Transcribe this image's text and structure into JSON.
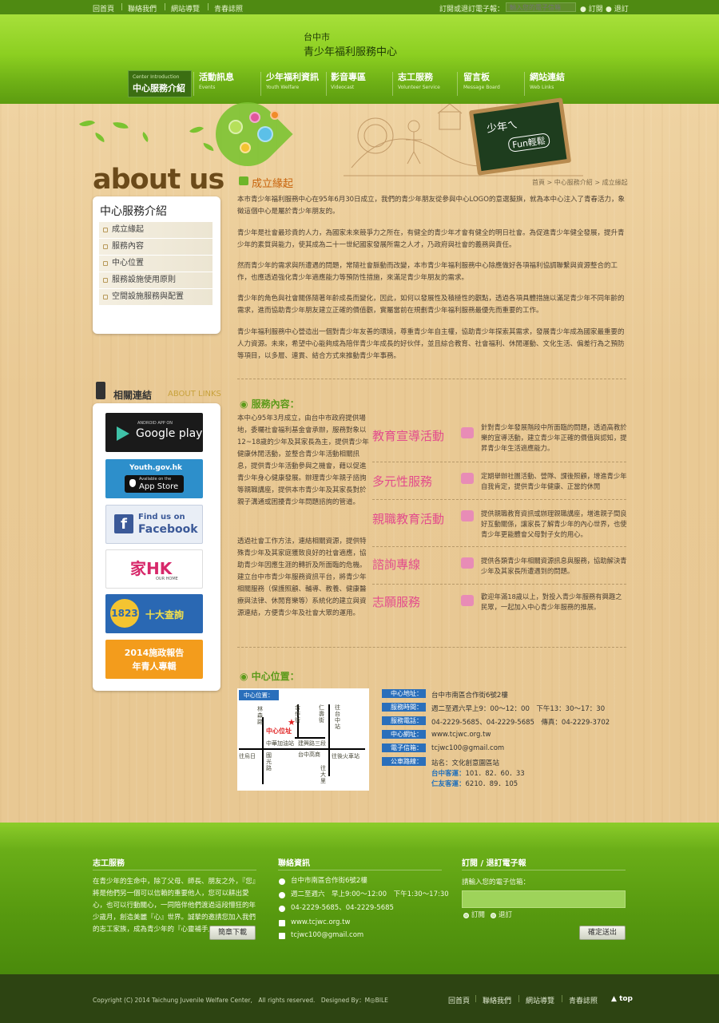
{
  "topbar": {
    "links": [
      "回首頁",
      "聯絡我們",
      "網站導覽",
      "青春誌照"
    ],
    "subscribe_label": "訂閱或退訂電子報：",
    "subscribe_placeholder": "輸入您的電子信箱",
    "subscribe_btn": "訂閱",
    "unsubscribe_btn": "退訂"
  },
  "header": {
    "title_line1": "台中市",
    "title_line2": "青少年福利服務中心"
  },
  "nav": [
    {
      "zh": "中心服務介紹",
      "en": "Center Introduction"
    },
    {
      "zh": "活動訊息",
      "en": "Events"
    },
    {
      "zh": "少年福利資訊",
      "en": "Youth Welfare"
    },
    {
      "zh": "影音專區",
      "en": "Videocast"
    },
    {
      "zh": "志工服務",
      "en": "Volunteer Service"
    },
    {
      "zh": "留言板",
      "en": "Message Board"
    },
    {
      "zh": "網站連結",
      "en": "Web Links"
    }
  ],
  "chalkboard": {
    "line1": "少年ㄟ",
    "line2": "Fun輕鬆"
  },
  "sidebar": {
    "about": "about us",
    "panel_title": "中心服務介紹",
    "items": [
      "成立緣起",
      "服務內容",
      "中心位置",
      "服務設施使用原則",
      "空間設施服務與配置"
    ],
    "links_title_zh": "相關連結",
    "links_title_en": "ABOUT LINKS",
    "links": [
      {
        "small": "ANDROID APP ON",
        "big": "Google play",
        "color": "#1a1a1a"
      },
      {
        "small": "Youth.gov.hk",
        "big": "App Store",
        "small2": "Available on the",
        "color": "#2d8fcb"
      },
      {
        "small": "Find us on",
        "big": "Facebook",
        "color": "#e9eef6"
      },
      {
        "small": "OUR HOME",
        "big": "家HK",
        "color": "#ffffff"
      },
      {
        "small": "1823",
        "big": "十大查詢",
        "color": "#2a68b3"
      },
      {
        "small": "2014施政報告",
        "big": "年青人專輯",
        "color": "#f39c1c"
      }
    ]
  },
  "breadcrumb": "首頁 > 中心服務介紹 > 成立緣起",
  "origin": {
    "title": "成立緣起",
    "paragraphs": [
      "本市青少年福利服務中心在95年6月30日成立，我們的青少年朋友從參與中心LOGO的意選擬旗，就為本中心注入了青春活力，象徵這個中心是屬於青少年朋友的。",
      "青少年是社會最珍貴的人力，為國家未來競爭力之所在，有健全的青少年才會有健全的明日社會。為促進青少年健全發展，提升青少年的素質與能力，使其成為二十一世紀國家發展所需之人才，乃政府與社會的義務與責任。",
      "然而青少年的需求與所遭遇的問題，常隨社會脈動而改變，本市青少年福利服務中心除應做好各項福利協調聯繫與資源整合的工作，也應透過強化青少年適應能力等預防性措施，來滿足青少年朋友的需求。",
      "青少年的角色與社會關係隨著年齡成長而變化，因此，如何以發展性及積極性的觀點，透過各項具體措施以滿足青少年不同年齡的需求，進而協助青少年朋友建立正確的價值觀，實屬當前在規劃青少年福利服務最優先而重要的工作。",
      "青少年福利服務中心營造出一個對青少年友善的環境，尊重青少年自主權，協助青少年探索其需求，發展青少年成為國家最重要的人力資源。未來，希望中心能夠成為陪伴青少年成長的好伙伴，並且綜合教育、社會福利、休閒運動、文化生活、偏差行為之預防等項目，以多層、連貫、結合方式來推動青少年事務。"
    ]
  },
  "services": {
    "title": "服務內容：",
    "intro1": "本中心95年3月成立，由台中市政府提供場地，委囑社會福利基金會承辦，服務對象以12~18歲的少年及其家長為主，提供青少年健康休閒活動，並整合青少年活動相關訊息，提供青少年活動參與之機會，藉以促進青少年身心健康發展。辦理青少年親子諮詢等親職講座，提供本市青少年及其家長對於親子溝通或困擾青少年問題諮詢的管道。",
    "intro2": "透過社會工作方法，連結相關資源，提供特殊青少年及其家庭獲致良好的社會適應，協助青少年因應生涯的轉折及所面臨的危機。建立台中市青少年服務資訊平台，將青少年相關服務（保護照顧、輔導、教養、健康醫療與法律、休閒育樂等）系統化的建立與資源連結，方便青少年及社會大眾的運用。",
    "items": [
      {
        "name": "教育宣導活動",
        "desc": "針對青少年發展階段中所面臨的問題，透過高教於樂的宣導活動，建立青少年正確的價值與認知，提昇青少年生活適應能力。"
      },
      {
        "name": "多元性服務",
        "desc": "定期舉辦社團活動、營隊、課後照顧，增進青少年自我肯定，提供青少年健康、正當的休閒"
      },
      {
        "name": "親職教育活動",
        "desc": "提供親職教育資訊或辦理親職講座，增進親子間良好互動關係，讓家長了解青少年的內心世界，也使青少年更能體會父母對子女的用心。"
      },
      {
        "name": "諮詢專線",
        "desc": "提供各類青少年相關資源訊息與服務，協助解決青少年及其家長所遭遇到的問題。"
      },
      {
        "name": "志願服務",
        "desc": "歡迎年滿18歲以上，對投入青少年服務有興趣之民眾，一起加入中心青少年服務的推展。"
      }
    ]
  },
  "location": {
    "title": "中心位置：",
    "map_label": "中心位置：",
    "map_center": "中心位址",
    "map_streets": [
      "林森路",
      "合作街",
      "仁壽街",
      "往台中站",
      "往火車站",
      "國光路",
      "往烏日",
      "往大里",
      "中華加油站",
      "建興路三段",
      "台中高商",
      "往後火車站"
    ],
    "rows": [
      {
        "label": "中心地址：",
        "value": "台中市南區合作街6號2樓"
      },
      {
        "label": "服務時間：",
        "value": "週二至週六早上9：00～12：00　下午13：30～17：30"
      },
      {
        "label": "服務電話：",
        "value": "04-2229-5685、04-2229-5685　傳真：04-2229-3702"
      },
      {
        "label": "中心網址：",
        "value": "www.tcjwc.org.tw"
      },
      {
        "label": "電子信箱：",
        "value": "tcjwc100@gmail.com"
      },
      {
        "label": "公車路線：",
        "value": "站名：文化創意園區站"
      }
    ],
    "bus": [
      {
        "name": "台中客運：",
        "routes": "101．82．60．33"
      },
      {
        "name": "仁友客運：",
        "routes": "6210．89．105"
      }
    ]
  },
  "footer": {
    "vol_title": "志工服務",
    "vol_text": "在青少年的生命中，除了父母、師長、朋友之外，『您』將是他們另一個可以信賴的重要他人，您可以耕出愛心，也可以行動關心，一同陪伴他們渡過這段懵狂的年少歲月，創造美麗『心』世界。誠摯的邀請您加入我們的志工家族，成為青少年的『心靈補手』。",
    "download_btn": "簡章下載",
    "contact_title": "聯絡資訊",
    "contact": [
      "台中市南區合作街6號2樓",
      "週二至週六　早上9:00～12:00　下午1:30～17:30",
      "04-2229-5685、04-2229-5685",
      "www.tcjwc.org.tw",
      "tcjwc100@gmail.com"
    ],
    "sub_title": "訂閱 / 退訂電子報",
    "sub_prompt": "請輸入您的電子信箱：",
    "sub_opt": "訂閱",
    "unsub_opt": "退訂",
    "submit_btn": "確定送出",
    "copyright": "Copyright (C) 2014 Taichung Juvenile Welfare Center,　All rights reserved.　Designed By：M◎BILE",
    "bottom_links": [
      "回首頁",
      "聯絡我們",
      "網站導覽",
      "青春誌照"
    ],
    "top": "top"
  }
}
